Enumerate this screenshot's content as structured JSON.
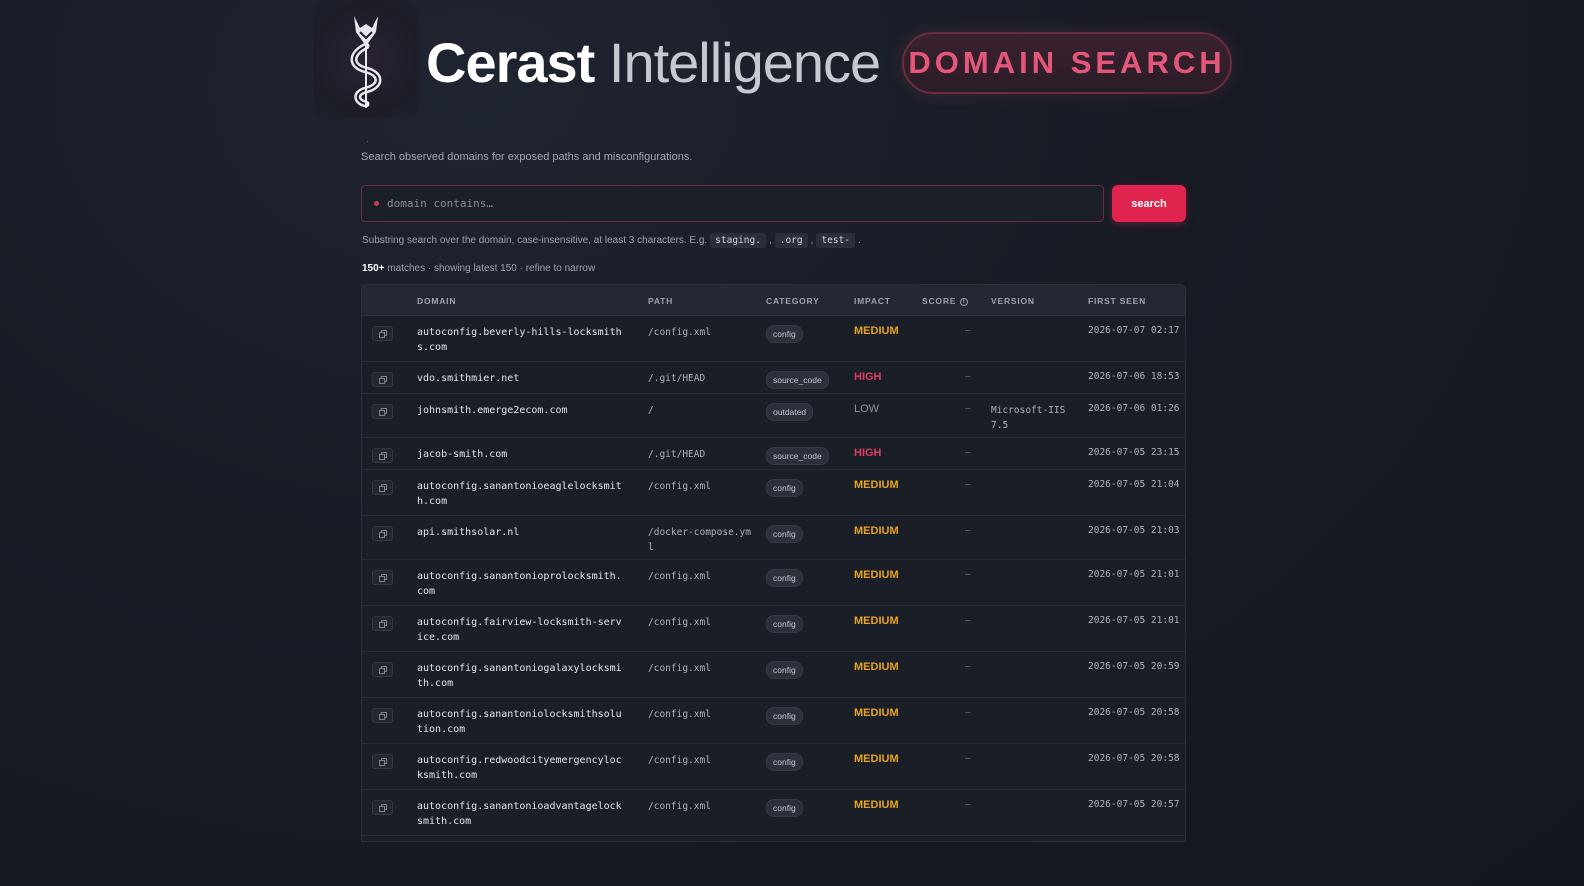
{
  "brand": {
    "part1": "Cerast",
    "part2": "Intelligence",
    "badge": "DOMAIN SEARCH"
  },
  "page": {
    "dot": "·",
    "subtitle": "Search observed domains for exposed paths and misconfigurations."
  },
  "search": {
    "placeholder": "domain contains…",
    "button": "search"
  },
  "hint": {
    "text": "Substring search over the domain, case-insensitive, at least 3 characters. E.g.",
    "examples": [
      "staging.",
      ".org",
      "test-"
    ],
    "sep": ",",
    "end": "."
  },
  "matches": {
    "count": "150+",
    "text": "matches · showing latest 150 · refine to narrow"
  },
  "table": {
    "headers": {
      "domain": "DOMAIN",
      "path": "PATH",
      "category": "CATEGORY",
      "impact": "IMPACT",
      "score": "SCORE",
      "version": "VERSION",
      "first_seen": "FIRST SEEN"
    },
    "rows": [
      {
        "domain": "autoconfig.beverly-hills-locksmiths.com",
        "path": "/config.xml",
        "category": "config",
        "impact": "MEDIUM",
        "score": "–",
        "version": "",
        "first_seen": "2026-07-07 02:17"
      },
      {
        "domain": "vdo.smithmier.net",
        "path": "/.git/HEAD",
        "category": "source_code",
        "impact": "HIGH",
        "score": "–",
        "version": "",
        "first_seen": "2026-07-06 18:53"
      },
      {
        "domain": "johnsmith.emerge2ecom.com",
        "path": "/",
        "category": "outdated",
        "impact": "LOW",
        "score": "–",
        "version": "Microsoft-IIS 7.5",
        "first_seen": "2026-07-06 01:26"
      },
      {
        "domain": "jacob-smith.com",
        "path": "/.git/HEAD",
        "category": "source_code",
        "impact": "HIGH",
        "score": "–",
        "version": "",
        "first_seen": "2026-07-05 23:15"
      },
      {
        "domain": "autoconfig.sanantonioeaglelocksmith.com",
        "path": "/config.xml",
        "category": "config",
        "impact": "MEDIUM",
        "score": "–",
        "version": "",
        "first_seen": "2026-07-05 21:04"
      },
      {
        "domain": "api.smithsolar.nl",
        "path": "/docker-compose.yml",
        "category": "config",
        "impact": "MEDIUM",
        "score": "–",
        "version": "",
        "first_seen": "2026-07-05 21:03"
      },
      {
        "domain": "autoconfig.sanantonioprolocksmith.com",
        "path": "/config.xml",
        "category": "config",
        "impact": "MEDIUM",
        "score": "–",
        "version": "",
        "first_seen": "2026-07-05 21:01"
      },
      {
        "domain": "autoconfig.fairview-locksmith-service.com",
        "path": "/config.xml",
        "category": "config",
        "impact": "MEDIUM",
        "score": "–",
        "version": "",
        "first_seen": "2026-07-05 21:01"
      },
      {
        "domain": "autoconfig.sanantoniogalaxylocksmith.com",
        "path": "/config.xml",
        "category": "config",
        "impact": "MEDIUM",
        "score": "–",
        "version": "",
        "first_seen": "2026-07-05 20:59"
      },
      {
        "domain": "autoconfig.sanantoniolocksmithsolution.com",
        "path": "/config.xml",
        "category": "config",
        "impact": "MEDIUM",
        "score": "–",
        "version": "",
        "first_seen": "2026-07-05 20:58"
      },
      {
        "domain": "autoconfig.redwoodcityemergencylocksmith.com",
        "path": "/config.xml",
        "category": "config",
        "impact": "MEDIUM",
        "score": "–",
        "version": "",
        "first_seen": "2026-07-05 20:58"
      },
      {
        "domain": "autoconfig.sanantonioadvantagelocksmith.com",
        "path": "/config.xml",
        "category": "config",
        "impact": "MEDIUM",
        "score": "–",
        "version": "",
        "first_seen": "2026-07-05 20:57"
      }
    ]
  }
}
